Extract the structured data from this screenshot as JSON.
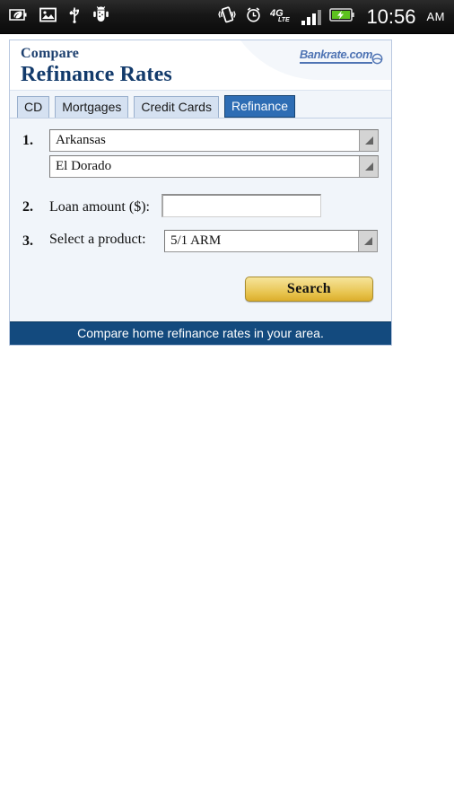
{
  "status_bar": {
    "left_icons": [
      {
        "name": "power-saver-leaf-icon",
        "label": "power saver"
      },
      {
        "name": "screenshot-image-icon",
        "label": "screenshot saved"
      },
      {
        "name": "usb-icon",
        "label": "USB connected"
      },
      {
        "name": "android-debug-icon",
        "label": "USB debugging"
      }
    ],
    "right_icons": [
      {
        "name": "vibrate-icon",
        "label": "vibrate"
      },
      {
        "name": "alarm-clock-icon",
        "label": "alarm set"
      },
      {
        "name": "network-4g-lte-icon",
        "label": "4G LTE"
      },
      {
        "name": "signal-bars-icon",
        "label": "signal strength"
      },
      {
        "name": "battery-charging-icon",
        "label": "battery charging"
      }
    ],
    "network_label": "4G",
    "network_sub": "LTE",
    "time": "10:56",
    "ampm": "AM"
  },
  "card": {
    "header": {
      "eyebrow": "Compare",
      "title": "Refinance Rates",
      "brand": "Bankrate.com"
    },
    "tabs": [
      {
        "label": "CD",
        "active": false
      },
      {
        "label": "Mortgages",
        "active": false
      },
      {
        "label": "Credit Cards",
        "active": false
      },
      {
        "label": "Refinance",
        "active": true
      }
    ],
    "form": {
      "step1": {
        "number": "1.",
        "state_value": "Arkansas",
        "city_value": "El Dorado"
      },
      "step2": {
        "number": "2.",
        "label": "Loan amount ($):",
        "value": "",
        "placeholder": ""
      },
      "step3": {
        "number": "3.",
        "label": "Select a product:",
        "value": "5/1 ARM"
      },
      "search_label": "Search"
    },
    "footer": "Compare home refinance rates in your area."
  },
  "colors": {
    "brand_blue": "#134a7e",
    "title_blue": "#123a6b",
    "tab_active_bg": "#2e6db4",
    "button_gold": "#e7c24b",
    "card_bg": "#f1f5fa"
  }
}
